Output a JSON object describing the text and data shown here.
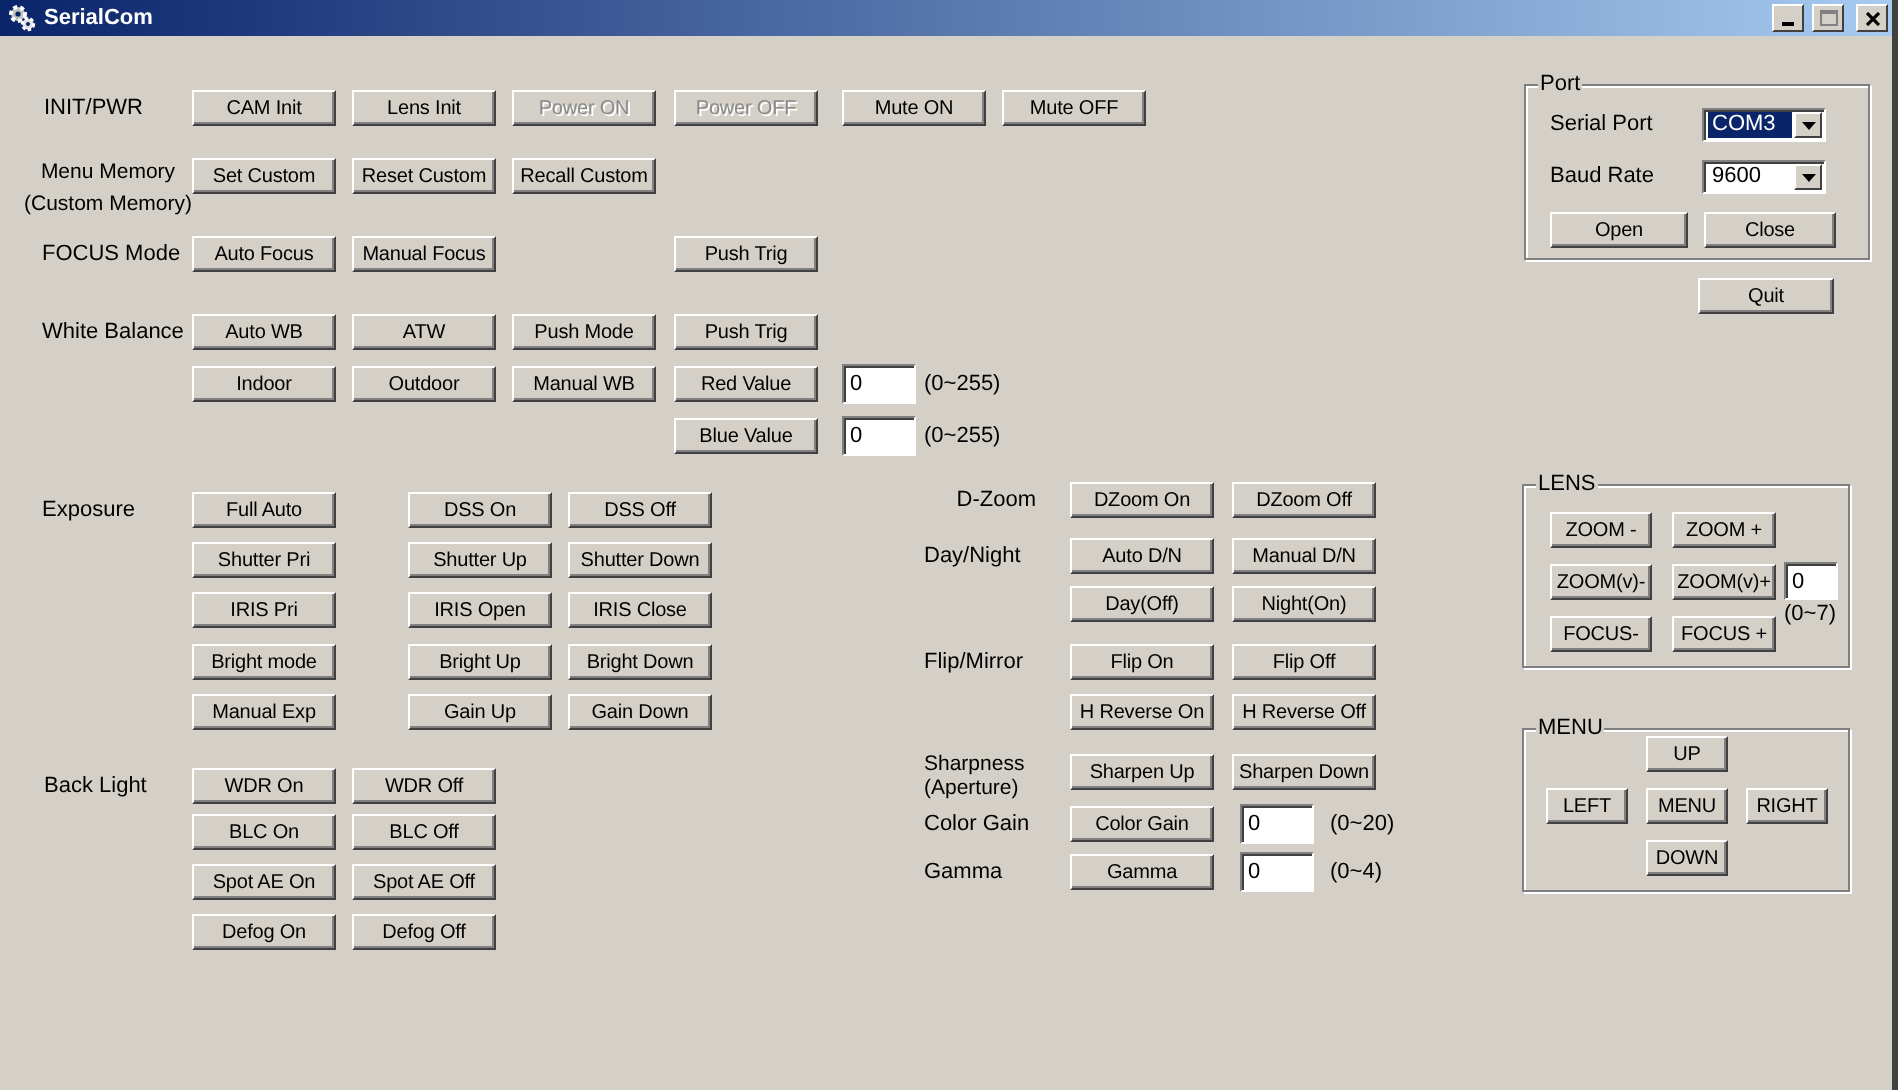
{
  "window": {
    "title": "SerialCom"
  },
  "sections": [
    {
      "label": "INIT/PWR",
      "rows": [
        [
          {
            "kind": "button",
            "label": "CAM Init",
            "disabled": false
          },
          {
            "kind": "button",
            "label": "Lens Init",
            "disabled": false
          },
          {
            "kind": "button",
            "label": "Power ON",
            "disabled": true
          },
          {
            "kind": "button",
            "label": "Power OFF",
            "disabled": true
          },
          {
            "kind": "button",
            "label": "Mute ON",
            "disabled": false
          },
          {
            "kind": "button",
            "label": "Mute OFF",
            "disabled": false
          }
        ]
      ]
    },
    {
      "label": "Menu Memory\n(Custom Memory)",
      "rows": [
        [
          {
            "kind": "button",
            "label": "Set Custom",
            "disabled": false
          },
          {
            "kind": "button",
            "label": "Reset Custom",
            "disabled": false
          },
          {
            "kind": "button",
            "label": "Recall Custom",
            "disabled": false
          }
        ]
      ]
    },
    {
      "label": "FOCUS Mode",
      "rows": [
        [
          {
            "kind": "button",
            "label": "Auto Focus",
            "disabled": false
          },
          {
            "kind": "button",
            "label": "Manual Focus",
            "disabled": false
          },
          "",
          {
            "kind": "button",
            "label": "Push Trig",
            "disabled": false
          }
        ]
      ]
    },
    {
      "label": "White Balance",
      "rows": [
        [
          {
            "kind": "button",
            "label": "Auto WB",
            "disabled": false
          },
          {
            "kind": "button",
            "label": "ATW",
            "disabled": false
          },
          {
            "kind": "button",
            "label": "Push Mode",
            "disabled": false
          },
          {
            "kind": "button",
            "label": "Push Trig",
            "disabled": false
          }
        ],
        [
          {
            "kind": "button",
            "label": "Indoor",
            "disabled": false
          },
          {
            "kind": "button",
            "label": "Outdoor",
            "disabled": false
          },
          {
            "kind": "button",
            "label": "Manual WB",
            "disabled": false
          },
          {
            "kind": "button",
            "label": "Red Value",
            "disabled": false
          },
          {
            "kind": "field",
            "value": "0"
          },
          {
            "kind": "hint",
            "text": "(0~255)"
          }
        ],
        [
          "",
          "",
          "",
          {
            "kind": "button",
            "label": "Blue Value",
            "disabled": false
          },
          {
            "kind": "field",
            "value": "0"
          },
          {
            "kind": "hint",
            "text": "(0~255)"
          }
        ]
      ]
    },
    {
      "label": "Exposure",
      "rows": [
        [
          {
            "kind": "button",
            "label": "Full Auto",
            "disabled": false
          },
          {
            "kind": "button",
            "label": "DSS On",
            "disabled": false
          },
          {
            "kind": "button",
            "label": "DSS Off",
            "disabled": false
          }
        ],
        [
          {
            "kind": "button",
            "label": "Shutter Pri",
            "disabled": false
          },
          {
            "kind": "button",
            "label": "Shutter Up",
            "disabled": false
          },
          {
            "kind": "button",
            "label": "Shutter Down",
            "disabled": false
          }
        ],
        [
          {
            "kind": "button",
            "label": "IRIS Pri",
            "disabled": false
          },
          {
            "kind": "button",
            "label": "IRIS Open",
            "disabled": false
          },
          {
            "kind": "button",
            "label": "IRIS Close",
            "disabled": false
          }
        ],
        [
          {
            "kind": "button",
            "label": "Bright mode",
            "disabled": false
          },
          {
            "kind": "button",
            "label": "Bright Up",
            "disabled": false
          },
          {
            "kind": "button",
            "label": "Bright Down",
            "disabled": false
          }
        ],
        [
          {
            "kind": "button",
            "label": "Manual Exp",
            "disabled": false
          },
          {
            "kind": "button",
            "label": "Gain Up",
            "disabled": false
          },
          {
            "kind": "button",
            "label": "Gain Down",
            "disabled": false
          }
        ]
      ]
    },
    {
      "label": "Back Light",
      "rows": [
        [
          {
            "kind": "button",
            "label": "WDR On",
            "disabled": false
          },
          {
            "kind": "button",
            "label": "WDR Off",
            "disabled": false
          }
        ],
        [
          {
            "kind": "button",
            "label": "BLC On",
            "disabled": false
          },
          {
            "kind": "button",
            "label": "BLC Off",
            "disabled": false
          }
        ],
        [
          {
            "kind": "button",
            "label": "Spot AE On",
            "disabled": false
          },
          {
            "kind": "button",
            "label": "Spot AE Off",
            "disabled": false
          }
        ],
        [
          {
            "kind": "button",
            "label": "Defog On",
            "disabled": false
          },
          {
            "kind": "button",
            "label": "Defog Off",
            "disabled": false
          }
        ]
      ]
    },
    {
      "label": "D-Zoom",
      "rows": [
        [
          {
            "kind": "button",
            "label": "DZoom On",
            "disabled": false
          },
          {
            "kind": "button",
            "label": "DZoom Off",
            "disabled": false
          }
        ]
      ]
    },
    {
      "label": "Day/Night",
      "rows": [
        [
          {
            "kind": "button",
            "label": "Auto D/N",
            "disabled": false
          },
          {
            "kind": "button",
            "label": "Manual D/N",
            "disabled": false
          }
        ],
        [
          {
            "kind": "button",
            "label": "Day(Off)",
            "disabled": false
          },
          {
            "kind": "button",
            "label": "Night(On)",
            "disabled": false
          }
        ]
      ]
    },
    {
      "label": "Flip/Mirror",
      "rows": [
        [
          {
            "kind": "button",
            "label": "Flip On",
            "disabled": false
          },
          {
            "kind": "button",
            "label": "Flip Off",
            "disabled": false
          }
        ],
        [
          {
            "kind": "button",
            "label": "H Reverse On",
            "disabled": false
          },
          {
            "kind": "button",
            "label": "H Reverse Off",
            "disabled": false
          }
        ]
      ]
    },
    {
      "label": "Sharpness\n(Aperture)",
      "rows": [
        [
          {
            "kind": "button",
            "label": "Sharpen Up",
            "disabled": false
          },
          {
            "kind": "button",
            "label": "Sharpen Down",
            "disabled": false
          }
        ]
      ]
    },
    {
      "label": "Color Gain",
      "rows": [
        [
          {
            "kind": "button",
            "label": "Color Gain",
            "disabled": false
          },
          {
            "kind": "field",
            "value": "0"
          },
          {
            "kind": "hint",
            "text": "(0~20)"
          }
        ]
      ]
    },
    {
      "label": "Gamma",
      "rows": [
        [
          {
            "kind": "button",
            "label": "Gamma",
            "disabled": false
          },
          {
            "kind": "field",
            "value": "0"
          },
          {
            "kind": "hint",
            "text": "(0~4)"
          }
        ]
      ]
    }
  ],
  "port": {
    "title": "Port",
    "fields": [
      {
        "label": "Serial Port",
        "value": "COM3",
        "highlighted": true
      },
      {
        "label": "Baud Rate",
        "value": "9600",
        "highlighted": false
      }
    ],
    "buttons": [
      "Open",
      "Close"
    ]
  },
  "quit": "Quit",
  "lens": {
    "title": "LENS",
    "items": [
      {
        "kind": "button",
        "label": "ZOOM -"
      },
      {
        "kind": "button",
        "label": "ZOOM +"
      },
      {
        "kind": "button",
        "label": "ZOOM(v)-"
      },
      {
        "kind": "button",
        "label": "ZOOM(v)+"
      },
      {
        "kind": "field",
        "value": "0"
      },
      {
        "kind": "button",
        "label": "FOCUS-"
      },
      {
        "kind": "button",
        "label": "FOCUS +"
      },
      {
        "kind": "hint",
        "text": "(0~7)"
      }
    ]
  },
  "menu": {
    "title": "MENU",
    "buttons": [
      "UP",
      "LEFT",
      "MENU",
      "RIGHT",
      "DOWN"
    ]
  }
}
